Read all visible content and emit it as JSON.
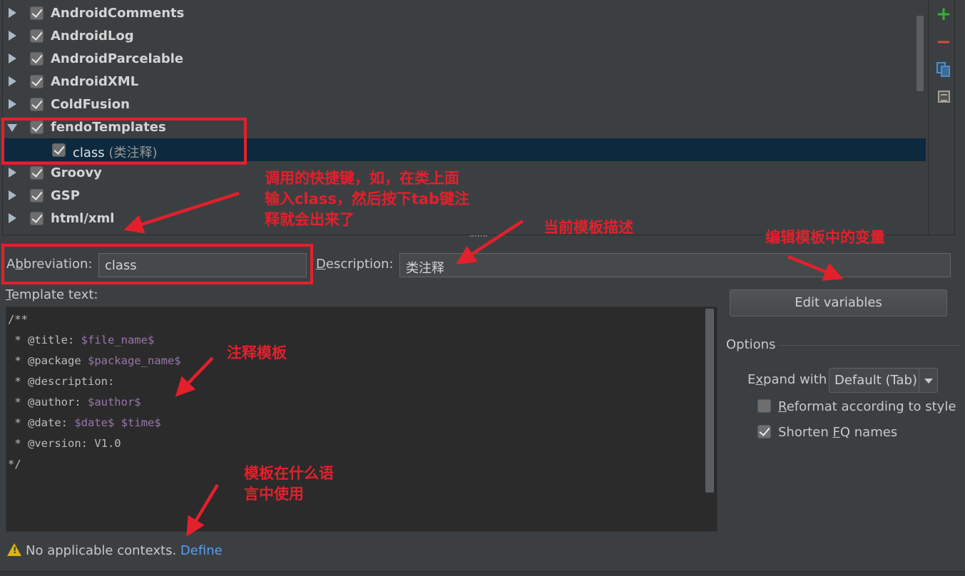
{
  "tree": {
    "groups": [
      {
        "label": "AndroidComments",
        "expanded": false,
        "checked": true
      },
      {
        "label": "AndroidLog",
        "expanded": false,
        "checked": true
      },
      {
        "label": "AndroidParcelable",
        "expanded": false,
        "checked": true
      },
      {
        "label": "AndroidXML",
        "expanded": false,
        "checked": true
      },
      {
        "label": "ColdFusion",
        "expanded": false,
        "checked": true
      },
      {
        "label": "fendoTemplates",
        "expanded": true,
        "checked": true
      },
      {
        "label": "Groovy",
        "expanded": false,
        "checked": true
      },
      {
        "label": "GSP",
        "expanded": false,
        "checked": true
      },
      {
        "label": "html/xml",
        "expanded": false,
        "checked": true
      }
    ],
    "child": {
      "label": "class",
      "description": "(类注释)",
      "checked": true,
      "selected": true
    }
  },
  "toolbar": {
    "icons": [
      "add-icon",
      "remove-icon",
      "copy-icon",
      "notes-icon"
    ]
  },
  "form": {
    "abbreviation_label_pre": "A",
    "abbreviation_label_mn": "b",
    "abbreviation_label_post": "breviation:",
    "abbreviation_value": "class",
    "description_label_mn": "D",
    "description_label_post": "escription:",
    "description_value": "类注释",
    "template_label_mn": "T",
    "template_label_post": "emplate text:",
    "template_lines": [
      "/**",
      " * @title: $file_name$",
      " * @package $package_name$",
      " * @description:",
      " * @author: $author$",
      " * @date: $date$ $time$",
      " * @version: V1.0",
      "*/"
    ]
  },
  "options": {
    "edit_variables_label": "Edit variables",
    "title": "Options",
    "expand_label_pre": "E",
    "expand_label_mn": "x",
    "expand_label_post": "pand with",
    "expand_value": "Default (Tab)",
    "reformat_label_mn": "R",
    "reformat_label_post": "eformat according to style",
    "reformat_checked": false,
    "shorten_label_pre": "Shorten ",
    "shorten_label_mn": "F",
    "shorten_label_post": "Q names",
    "shorten_checked": true
  },
  "status": {
    "message": "No applicable contexts.",
    "link": "Define"
  },
  "annotations": {
    "shortcut_lines": [
      "调用的快捷键，如，在类上面",
      "输入class，然后按下tab键注",
      "释就会出来了"
    ],
    "description_note": "当前模板描述",
    "variables_note": "编辑模板中的变量",
    "template_note": "注释模板",
    "context_lines": [
      "模板在什么语",
      "言中使用"
    ]
  },
  "colors": {
    "accent_red": "#e3202c",
    "selection": "#0d293e",
    "link": "#589df6",
    "template_variable": "#9876aa"
  }
}
